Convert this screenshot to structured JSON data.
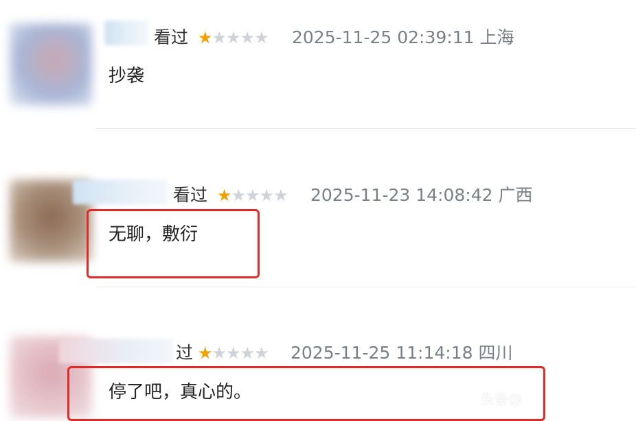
{
  "reviews": [
    {
      "status": "看过",
      "rating": 1,
      "max_rating": 5,
      "time": "2025-11-25 02:39:11",
      "location": "上海",
      "comment": "抄袭",
      "highlighted": false
    },
    {
      "status": "看过",
      "rating": 1,
      "max_rating": 5,
      "time": "2025-11-23 14:08:42",
      "location": "广西",
      "comment": "无聊，敷衍",
      "highlighted": true
    },
    {
      "status": "过",
      "rating": 1,
      "max_rating": 5,
      "time": "2025-11-25 11:14:18",
      "location": "四川",
      "comment": "停了吧，真心的。",
      "highlighted": true
    }
  ],
  "colors": {
    "star_on": "#f0a000",
    "star_off": "#cfd2d6",
    "highlight": "#e02a25"
  },
  "watermark": "头条@"
}
